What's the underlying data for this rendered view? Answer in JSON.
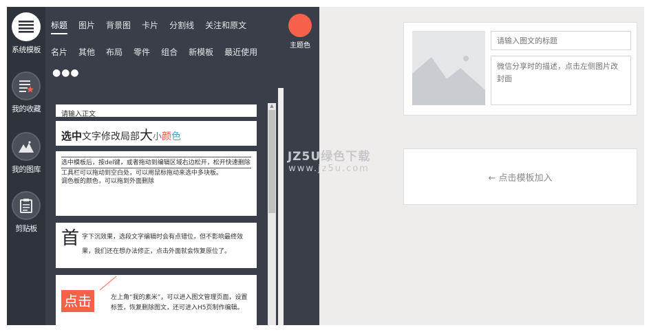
{
  "rail": {
    "items": [
      {
        "label": "系统模板",
        "icon": "menu-icon"
      },
      {
        "label": "我的收藏",
        "icon": "favorites-icon"
      },
      {
        "label": "我的图库",
        "icon": "image-library-icon"
      },
      {
        "label": "剪贴板",
        "icon": "clipboard-icon"
      }
    ]
  },
  "panel": {
    "tabs_row1": [
      "标题",
      "图片",
      "背景图",
      "卡片",
      "分割线",
      "关注和原文"
    ],
    "tabs_row2": [
      "名片",
      "其他",
      "布局",
      "零件",
      "组合",
      "新模板",
      "最近使用"
    ],
    "more": "●●●",
    "theme_label": "主题色"
  },
  "colors": {
    "accent": "#f5614b",
    "panel_bg": "#3a3e48",
    "rail_bg": "#2f333c",
    "canvas_bg": "#eeedeb"
  },
  "templates": {
    "t1_text": "请输入正文",
    "t2": {
      "p1": "选中",
      "p2": "文字修改局部",
      "p3": "大",
      "p4": "小",
      "p5": "颜",
      "p6": "色"
    },
    "t3": {
      "line1": "选中模板后，按del键，或者拖动到编辑区域右边松开，松开快速删除",
      "line2": "工具栏可以拖动到空白处，可以用鼠标拖动来选中多块板。",
      "line3": "调色板的颜色，可以拖到外面删除"
    },
    "t4": {
      "big": "首",
      "rest": "字下沉效果，选段文字编辑时会有点错位，但不影响最终效果，我们还在想办法修正，点击外面就会恢复原位了。"
    },
    "t5": {
      "badge": "点击",
      "text": "左上角“我的素米”，可以进入图文管理页面，设置标签，恢复删除图文，还可进入H5页制作编辑。"
    }
  },
  "editor": {
    "title_placeholder": "请输入图文的标题",
    "desc_placeholder": "微信分享时的描述，点击左侧图片改封面",
    "add_template_label": "← 点击模板加入"
  },
  "watermark": {
    "line1": "JZ5U绿色下载",
    "line2": "www.jz5u.com"
  }
}
